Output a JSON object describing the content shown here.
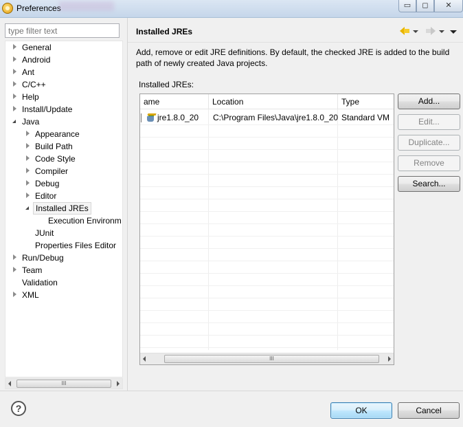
{
  "window": {
    "title": "Preferences",
    "controls": {
      "minimize": "▭",
      "maximize": "◻",
      "close": "✕"
    }
  },
  "sidebar": {
    "filter_placeholder": "type filter text",
    "items": [
      {
        "label": "General",
        "state": "collapsed"
      },
      {
        "label": "Android",
        "state": "collapsed"
      },
      {
        "label": "Ant",
        "state": "collapsed"
      },
      {
        "label": "C/C++",
        "state": "collapsed"
      },
      {
        "label": "Help",
        "state": "collapsed"
      },
      {
        "label": "Install/Update",
        "state": "collapsed"
      },
      {
        "label": "Java",
        "state": "expanded"
      },
      {
        "label": "Appearance",
        "state": "collapsed"
      },
      {
        "label": "Build Path",
        "state": "collapsed"
      },
      {
        "label": "Code Style",
        "state": "collapsed"
      },
      {
        "label": "Compiler",
        "state": "collapsed"
      },
      {
        "label": "Debug",
        "state": "collapsed"
      },
      {
        "label": "Editor",
        "state": "collapsed"
      },
      {
        "label": "Installed JREs",
        "state": "expanded",
        "selected": true
      },
      {
        "label": "Execution Environm",
        "state": "leaf"
      },
      {
        "label": "JUnit",
        "state": "leaf"
      },
      {
        "label": "Properties Files Editor",
        "state": "leaf"
      },
      {
        "label": "Run/Debug",
        "state": "collapsed"
      },
      {
        "label": "Team",
        "state": "collapsed"
      },
      {
        "label": "Validation",
        "state": "leaf"
      },
      {
        "label": "XML",
        "state": "collapsed"
      }
    ],
    "scroll_grip": "III"
  },
  "page": {
    "title": "Installed JREs",
    "description": "Add, remove or edit JRE definitions. By default, the checked JRE is added to the build path of newly created Java projects.",
    "list_label": "Installed JREs:",
    "table": {
      "columns": [
        "ame",
        "Location",
        "Type"
      ],
      "rows": [
        {
          "name": "jre1.8.0_20",
          "location": "C:\\Program Files\\Java\\jre1.8.0_20",
          "type": "Standard VM",
          "checked": true
        }
      ]
    },
    "table_scroll_grip": "III",
    "buttons": {
      "add": "Add...",
      "edit": "Edit...",
      "duplicate": "Duplicate...",
      "remove": "Remove",
      "search": "Search..."
    }
  },
  "footer": {
    "help": "?",
    "ok": "OK",
    "cancel": "Cancel"
  },
  "colors": {
    "title_bar": "#c5d6ea",
    "primary_button": "#bee6fd",
    "disabled_text": "#838383"
  }
}
